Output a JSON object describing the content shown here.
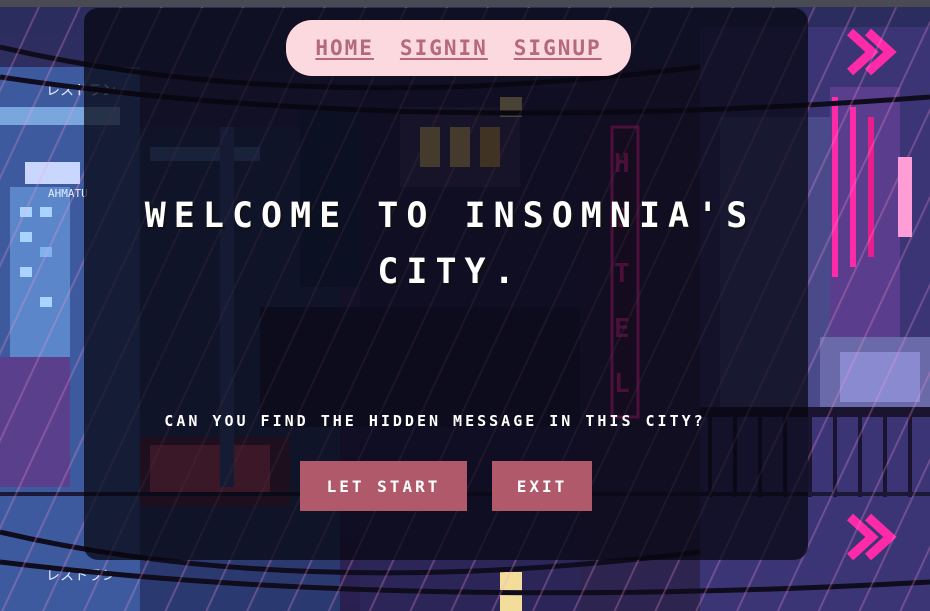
{
  "nav": {
    "home": "HOME",
    "signin": "SIGNIN",
    "signup": "SIGNUP"
  },
  "hero": {
    "title": "WELCOME TO INSOMNIA'S CITY.",
    "question": "CAN YOU FIND THE HIDDEN MESSAGE IN THIS CITY?"
  },
  "actions": {
    "start_label": "LET START",
    "exit_label": "EXIT"
  },
  "background": {
    "sign_left": "レストラン",
    "sign_hotel": "HOTEL",
    "sign_small": "AHMATU"
  },
  "colors": {
    "nav_bg": "#fcd9df",
    "nav_link": "#b4697f",
    "button_bg": "#b0596a",
    "overlay": "#06050e",
    "neon_pink": "#ff2aa8"
  }
}
